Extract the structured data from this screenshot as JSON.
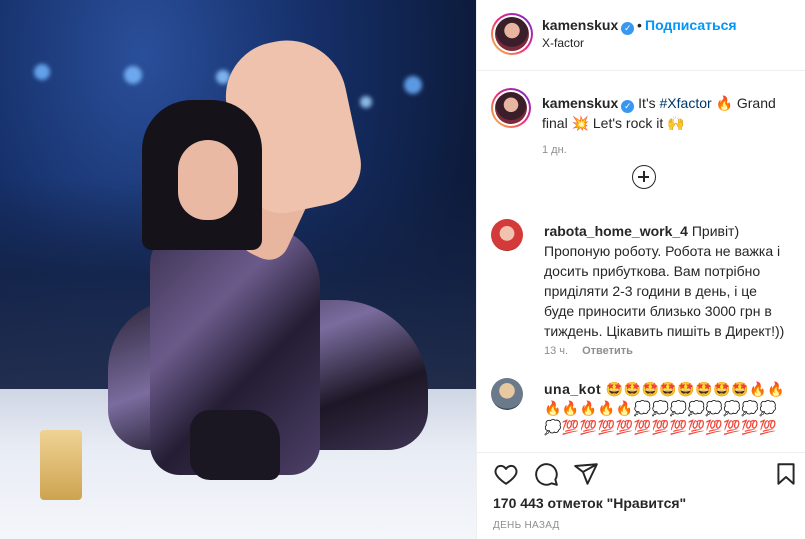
{
  "post_header": {
    "username": "kamenskux",
    "follow_label": "Подписаться",
    "separator": "•",
    "location": "X-factor"
  },
  "caption": {
    "username": "kamenskux",
    "text_before_tag": "It's ",
    "hashtag": "#Xfactor",
    "text_after_tag": " 🔥 Grand final 💥 Let's rock it 🙌",
    "time": "1 дн."
  },
  "comments": [
    {
      "username": "rabota_home_work_4",
      "text": "Привіт) Пропоную роботу. Робота не важка і досить прибуткова. Вам потрібно приділяти 2-3 години в день, і це буде приносити близько 3000 грн в тиждень. Цікавить пишіть в Директ!))",
      "time": "13 ч.",
      "reply_label": "Ответить"
    },
    {
      "username": "una_kot",
      "text": "🤩🤩🤩🤩🤩🤩🤩🤩🔥🔥🔥🔥🔥🔥🔥💭💭💭💭💭💭💭💭💭💯💯💯💯💯💯💯💯💯💯💯💯"
    }
  ],
  "actions": {
    "likes": "170 443 отметок \"Нравится\"",
    "date": "ДЕНЬ НАЗАД"
  },
  "icons": {
    "verified": "verified-badge-icon",
    "plus": "load-more-comments-icon",
    "like": "heart-icon",
    "comment": "comment-bubble-icon",
    "share": "paper-plane-icon",
    "save": "bookmark-icon"
  },
  "colors": {
    "accent": "#0095f6",
    "verified": "#3897f0",
    "muted": "#8e8e8e",
    "text": "#262626"
  }
}
